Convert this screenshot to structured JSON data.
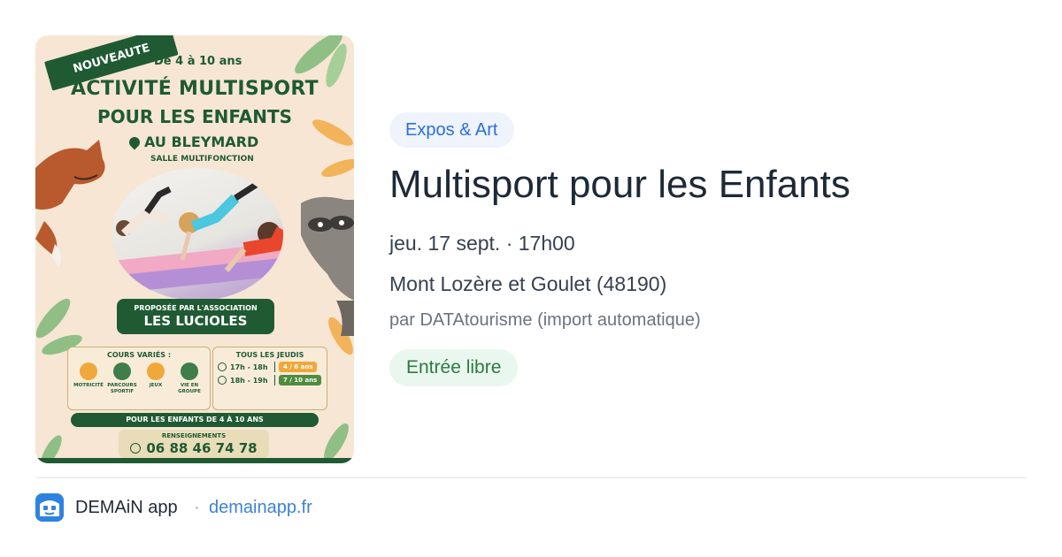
{
  "poster": {
    "ribbon": "NOUVEAUTE",
    "age_range": "De 4 à 10 ans",
    "title_line1": "ACTIVITÉ MULTISPORT",
    "title_line2": "POUR LES ENFANTS",
    "place": "AU BLEYMARD",
    "hall": "SALLE MULTIFONCTION",
    "association_prefix": "PROPOSÉE PAR L'ASSOCIATION",
    "association_name": "LES LUCIOLES",
    "courses_title": "COURS VARIÉS :",
    "activities": [
      {
        "label": "MOTRICITÉ",
        "color": "#f0a83a"
      },
      {
        "label": "PARCOURS SPORTIF",
        "color": "#3f7d4b"
      },
      {
        "label": "JEUX",
        "color": "#f0a83a"
      },
      {
        "label": "VIE EN GROUPE",
        "color": "#3f7d4b"
      }
    ],
    "schedule_title": "TOUS LES JEUDIS",
    "schedule": [
      {
        "time": "17h - 18h",
        "age": "4 / 6 ans",
        "color": "#f0a83a"
      },
      {
        "time": "18h - 19h",
        "age": "7 / 10 ans",
        "color": "#4f8c3d"
      }
    ],
    "for_kids": "POUR LES ENFANTS DE 4 À 10 ANS",
    "info_label": "RENSEIGNEMENTS",
    "phone": "06 88 46 74 78"
  },
  "event": {
    "category": "Expos & Art",
    "title": "Multisport pour les Enfants",
    "datetime": "jeu. 17 sept. · 17h00",
    "location": "Mont Lozère et Goulet (48190)",
    "source": "par DATAtourisme (import automatique)",
    "price": "Entrée libre"
  },
  "footer": {
    "app_name": "DEMAiN app",
    "separator": "·",
    "domain": "demainapp.fr"
  },
  "colors": {
    "poster_green": "#1f5a33",
    "badge_blue": "#2f6fd6",
    "price_green": "#2c7a43",
    "link_blue": "#3b82d6"
  }
}
